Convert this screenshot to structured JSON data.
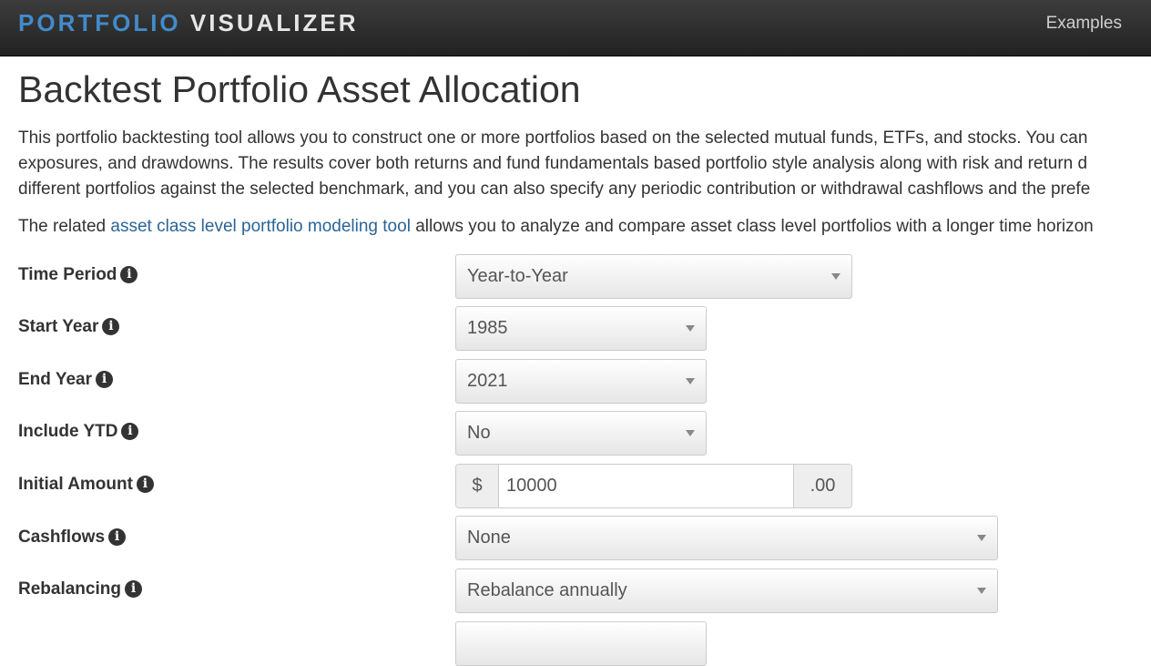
{
  "navbar": {
    "brand_part1": "PORTFOLIO",
    "brand_part2": "VISUALIZER",
    "examples_label": "Examples"
  },
  "page": {
    "title": "Backtest Portfolio Asset Allocation",
    "intro_lines": [
      "This portfolio backtesting tool allows you to construct one or more portfolios based on the selected mutual funds, ETFs, and stocks. You can",
      "exposures, and drawdowns. The results cover both returns and fund fundamentals based portfolio style analysis along with risk and return d",
      "different portfolios against the selected benchmark, and you can also specify any periodic contribution or withdrawal cashflows and the prefe"
    ],
    "related": {
      "prefix": "The related ",
      "link_text": "asset class level portfolio modeling tool",
      "suffix": " allows you to analyze and compare asset class level portfolios with a longer time horizon"
    }
  },
  "form": {
    "time_period": {
      "label": "Time Period",
      "value": "Year-to-Year"
    },
    "start_year": {
      "label": "Start Year",
      "value": "1985"
    },
    "end_year": {
      "label": "End Year",
      "value": "2021"
    },
    "include_ytd": {
      "label": "Include YTD",
      "value": "No"
    },
    "initial_amount": {
      "label": "Initial Amount",
      "prefix": "$",
      "value": "10000",
      "suffix": ".00"
    },
    "cashflows": {
      "label": "Cashflows",
      "value": "None"
    },
    "rebalancing": {
      "label": "Rebalancing",
      "value": "Rebalance annually"
    },
    "info_glyph": "i"
  },
  "colors": {
    "brand_blue": "#428bca",
    "link_blue": "#2a6496",
    "navbar_bg": "#222222"
  }
}
